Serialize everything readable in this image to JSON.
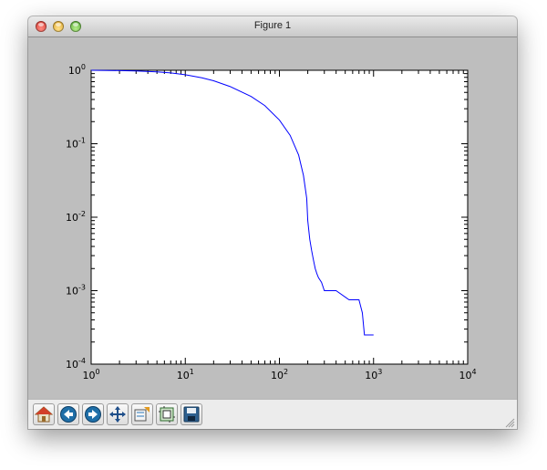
{
  "window": {
    "title": "Figure 1"
  },
  "toolbar": {
    "buttons": [
      {
        "name": "home",
        "icon": "home-icon"
      },
      {
        "name": "back",
        "icon": "back-arrow-icon"
      },
      {
        "name": "forward",
        "icon": "forward-arrow-icon"
      },
      {
        "name": "pan",
        "icon": "move-arrows-icon"
      },
      {
        "name": "zoom",
        "icon": "zoom-rectangle-icon"
      },
      {
        "name": "subplots",
        "icon": "subplots-config-icon"
      },
      {
        "name": "save",
        "icon": "floppy-disk-icon"
      }
    ]
  },
  "colors": {
    "line": "#0000ff",
    "window_bg": "#bebebe",
    "plot_bg": "#ffffff"
  },
  "chart_data": {
    "type": "line",
    "xscale": "log",
    "yscale": "log",
    "xlim": [
      1,
      10000
    ],
    "ylim": [
      0.0001,
      1
    ],
    "grid": false,
    "x_ticks": [
      {
        "base": "10",
        "exp": "0"
      },
      {
        "base": "10",
        "exp": "1"
      },
      {
        "base": "10",
        "exp": "2"
      },
      {
        "base": "10",
        "exp": "3"
      },
      {
        "base": "10",
        "exp": "4"
      }
    ],
    "y_ticks": [
      {
        "base": "10",
        "exp": "-4"
      },
      {
        "base": "10",
        "exp": "-3"
      },
      {
        "base": "10",
        "exp": "-2"
      },
      {
        "base": "10",
        "exp": "-1"
      },
      {
        "base": "10",
        "exp": "0"
      }
    ],
    "series": [
      {
        "x": [
          1,
          2,
          3,
          5,
          7,
          10,
          15,
          20,
          30,
          50,
          70,
          100,
          130,
          160,
          180,
          195,
          200,
          210,
          220,
          230,
          240,
          250,
          260,
          280,
          300,
          400,
          550,
          700,
          760,
          800,
          1000
        ],
        "y": [
          1.0,
          0.99,
          0.98,
          0.95,
          0.92,
          0.87,
          0.79,
          0.72,
          0.6,
          0.44,
          0.33,
          0.21,
          0.13,
          0.07,
          0.037,
          0.018,
          0.009,
          0.005,
          0.0035,
          0.0026,
          0.002,
          0.0017,
          0.0015,
          0.0013,
          0.001,
          0.001,
          0.00075,
          0.00075,
          0.0005,
          0.00025,
          0.00025
        ]
      }
    ]
  }
}
